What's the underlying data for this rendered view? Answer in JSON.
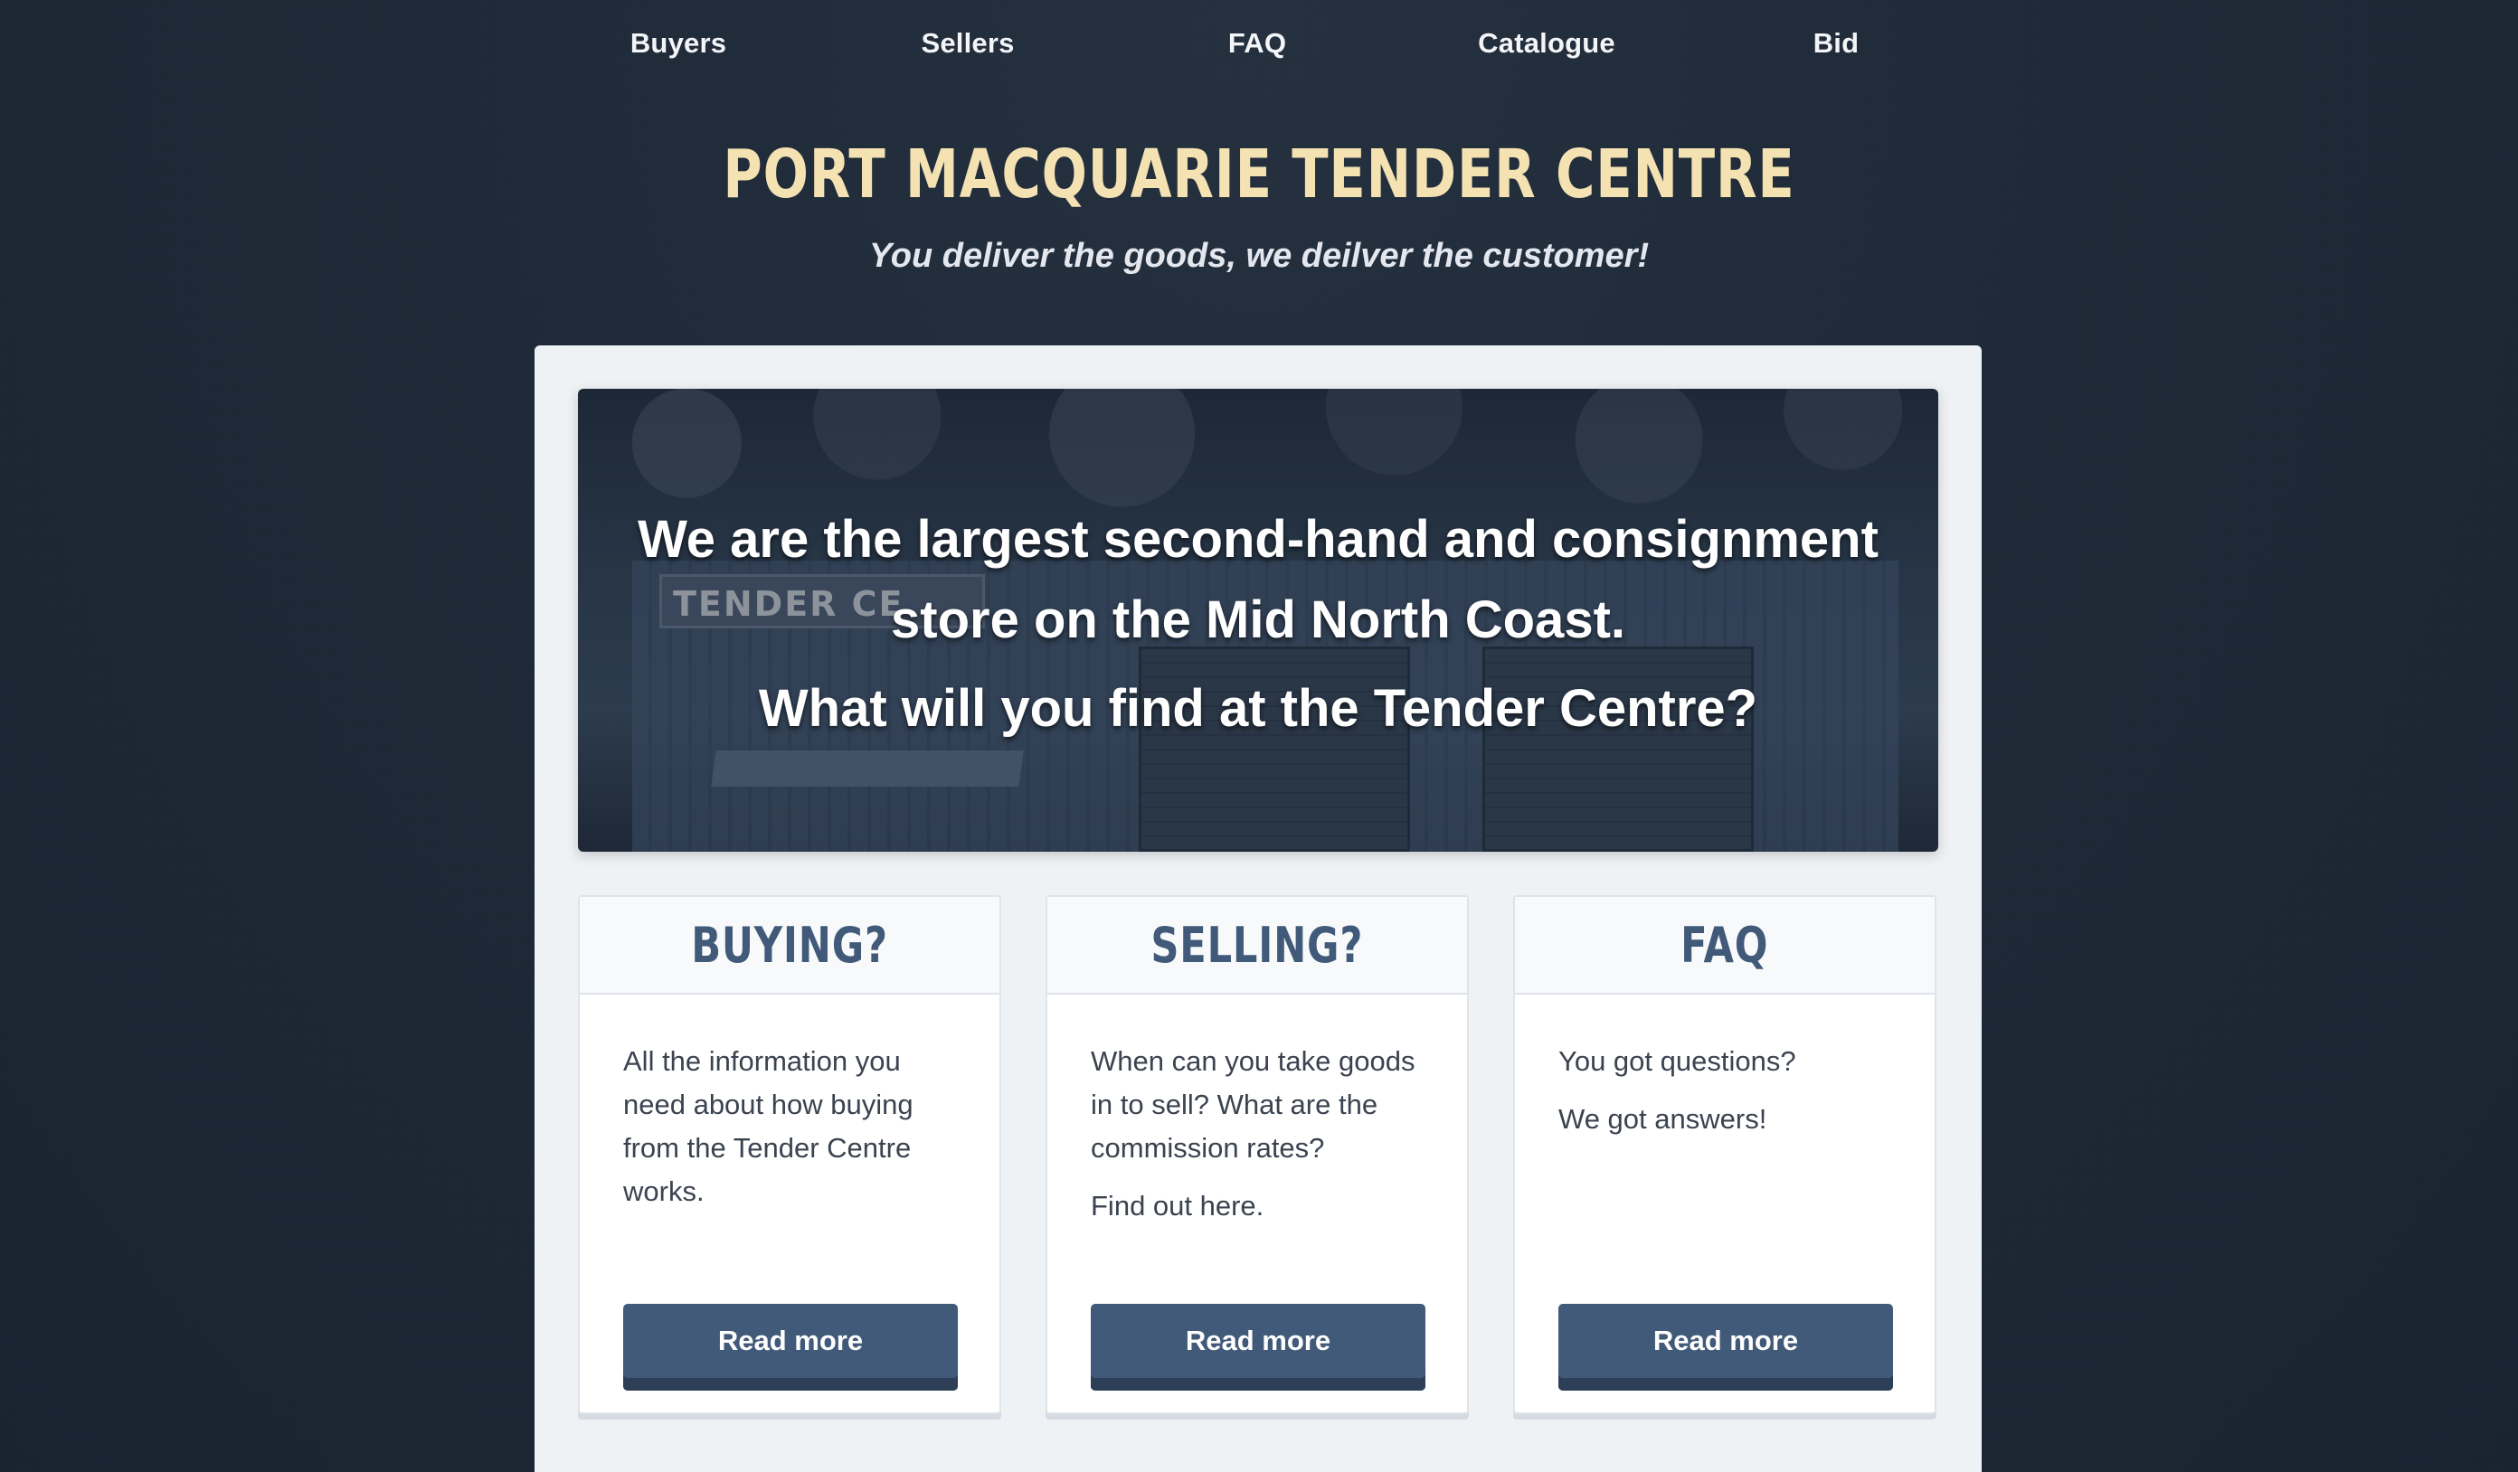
{
  "nav": {
    "items": [
      {
        "label": "Buyers"
      },
      {
        "label": "Sellers"
      },
      {
        "label": "FAQ"
      },
      {
        "label": "Catalogue"
      },
      {
        "label": "Bid"
      }
    ]
  },
  "header": {
    "title": "PORT MACQUARIE TENDER CENTRE",
    "tagline": "You deliver the goods, we deilver the customer!"
  },
  "hero": {
    "line1": "We are the largest second-hand and consignment store on the Mid North Coast.",
    "line2": "What will you find at the Tender Centre?",
    "sign_text": "TENDER CE"
  },
  "cards": [
    {
      "title": "BUYING?",
      "paragraphs": [
        "All the information you need about how buying from the Tender Centre works."
      ],
      "button": "Read more"
    },
    {
      "title": "SELLING?",
      "paragraphs": [
        "When can you take goods in to sell? What are the commission rates?",
        "Find out here."
      ],
      "button": "Read more"
    },
    {
      "title": "FAQ",
      "paragraphs": [
        "You got questions?",
        "We got answers!"
      ],
      "button": "Read more"
    }
  ],
  "colors": {
    "background": "#1f2a38",
    "title": "#f4e2b2",
    "accent": "#415a79",
    "panel": "#eff2f5"
  }
}
